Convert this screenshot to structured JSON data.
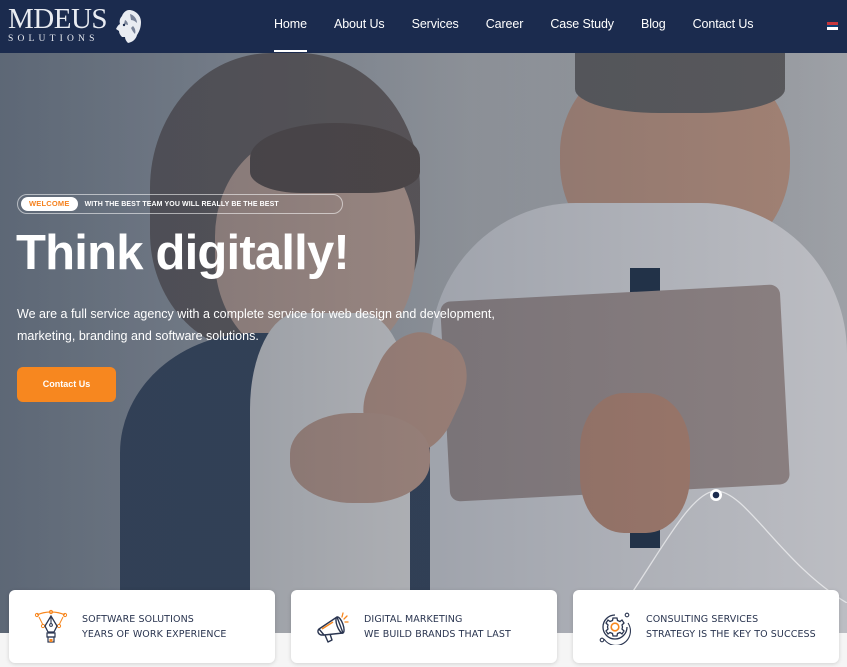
{
  "header": {
    "logo": {
      "main": "MDEUS",
      "sub": "SOLUTIONS",
      "icon": "lion-head-icon"
    },
    "nav": [
      {
        "label": "Home",
        "active": true
      },
      {
        "label": "About Us",
        "active": false
      },
      {
        "label": "Services",
        "active": false
      },
      {
        "label": "Career",
        "active": false
      },
      {
        "label": "Case Study",
        "active": false
      },
      {
        "label": "Blog",
        "active": false
      },
      {
        "label": "Contact Us",
        "active": false
      }
    ],
    "language_flag": "serbian-flag-icon"
  },
  "hero": {
    "welcome_badge": "WELCOME",
    "welcome_text": "WITH THE BEST TEAM YOU WILL REALLY BE THE BEST",
    "title": "Think digitally!",
    "description": "We are a full service agency with a complete service for web design and development, marketing, branding and software solutions.",
    "cta_label": "Contact Us"
  },
  "features": [
    {
      "icon": "pen-tool-icon",
      "title": "SOFTWARE SOLUTIONS",
      "subtitle": "YEARS OF WORK EXPERIENCE"
    },
    {
      "icon": "megaphone-icon",
      "title": "DIGITAL MARKETING",
      "subtitle": "WE BUILD BRANDS THAT LAST"
    },
    {
      "icon": "gear-orbit-icon",
      "title": "CONSULTING SERVICES",
      "subtitle": "STRATEGY IS THE KEY TO SUCCESS"
    }
  ],
  "colors": {
    "header_bg": "#1b2b4e",
    "accent": "#f7871f",
    "card_text": "#2a3550"
  }
}
